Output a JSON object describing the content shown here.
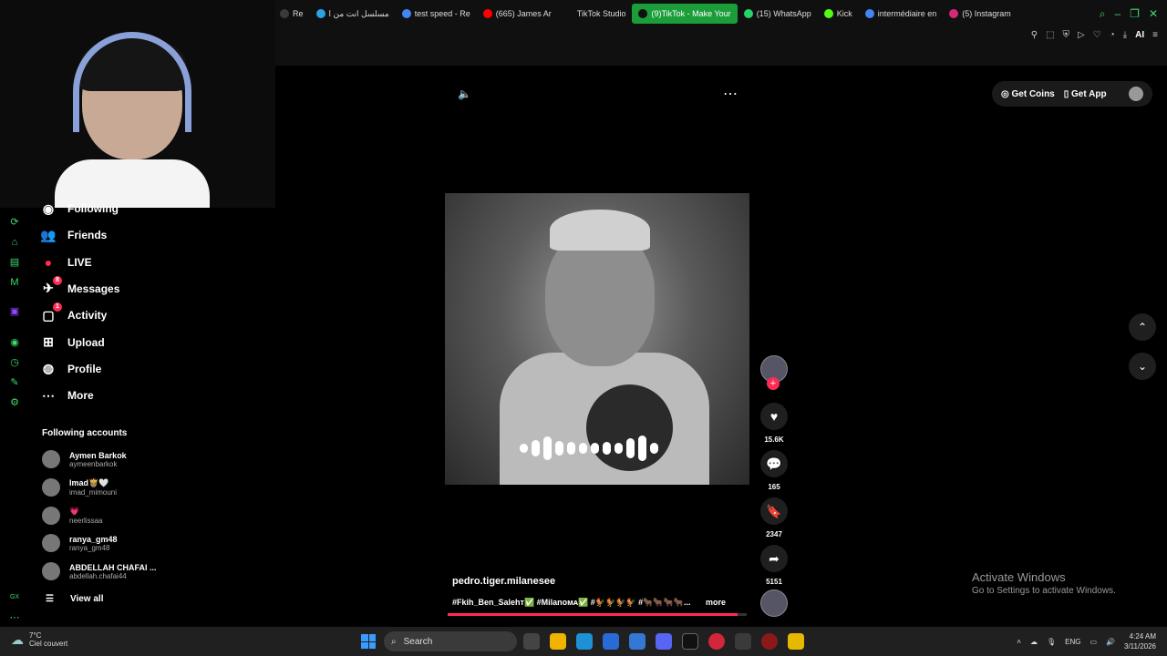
{
  "browser": {
    "tabs": [
      {
        "label": "Re",
        "icon": "generic-icon",
        "color": "#3a3a3a"
      },
      {
        "label": "مسلسل انت من ا",
        "icon": "telegram-icon",
        "color": "#2aa3df"
      },
      {
        "label": "test speed - Re",
        "icon": "chrome-icon",
        "color": "#4285f4"
      },
      {
        "label": "(665) James Ar",
        "icon": "youtube-icon",
        "color": "#ff0000"
      },
      {
        "label": "TikTok Studio",
        "icon": "tiktok-icon",
        "color": "#111111"
      },
      {
        "label": "(9)TikTok - Make Your",
        "icon": "tiktok-icon",
        "color": "#111111",
        "active": true
      },
      {
        "label": "(15) WhatsApp",
        "icon": "whatsapp-icon",
        "color": "#25d366"
      },
      {
        "label": "Kick",
        "icon": "kick-icon",
        "color": "#53fc18"
      },
      {
        "label": "intermédiaire en",
        "icon": "chrome-icon",
        "color": "#4285f4"
      },
      {
        "label": "(5) Instagram",
        "icon": "instagram-icon",
        "color": "#d62976"
      }
    ],
    "toolbar_ai": "AI"
  },
  "sidebar": {
    "nav": [
      {
        "label": "Following",
        "icon": "following-icon",
        "badge": ""
      },
      {
        "label": "Friends",
        "icon": "friends-icon",
        "badge": ""
      },
      {
        "label": "LIVE",
        "icon": "live-icon",
        "badge": ""
      },
      {
        "label": "Messages",
        "icon": "messages-icon",
        "badge": "8"
      },
      {
        "label": "Activity",
        "icon": "activity-icon",
        "badge": "1"
      },
      {
        "label": "Upload",
        "icon": "upload-icon",
        "badge": ""
      },
      {
        "label": "Profile",
        "icon": "profile-icon",
        "badge": ""
      },
      {
        "label": "More",
        "icon": "more-icon",
        "badge": ""
      }
    ],
    "following_title": "Following accounts",
    "accounts": [
      {
        "name": "Aymen Barkok",
        "handle": "aymeenbarkok"
      },
      {
        "name": "Imad🤴🏽🤍",
        "handle": "imad_mimouni"
      },
      {
        "name": "💗",
        "handle": "neerlissaa"
      },
      {
        "name": "ranya_gm48",
        "handle": "ranya_gm48"
      },
      {
        "name": "ABDELLAH CHAFAI ...",
        "handle": "abdellah.chafai44"
      }
    ],
    "view_all": "View all"
  },
  "header": {
    "get_coins": "Get Coins",
    "get_app": "Get App"
  },
  "video": {
    "username": "pedro.tiger.milanesee",
    "caption": "#Fkih_Ben_Salehᴛ✅ #Milanoᴍᴀ✅ #🐓🐓🐓🐓 #🐂🐂🐂🐂...",
    "more": "more",
    "progress": 0.97,
    "likes": "15.6K",
    "comments": "165",
    "saves": "2347",
    "shares": "5151"
  },
  "windows_watermark": {
    "title": "Activate Windows",
    "subtitle": "Go to Settings to activate Windows."
  },
  "taskbar": {
    "temp": "7°C",
    "weather": "Ciel couvert",
    "search": "Search",
    "lang": "ENG",
    "time": "4:24 AM",
    "date": "3/11/2026"
  }
}
